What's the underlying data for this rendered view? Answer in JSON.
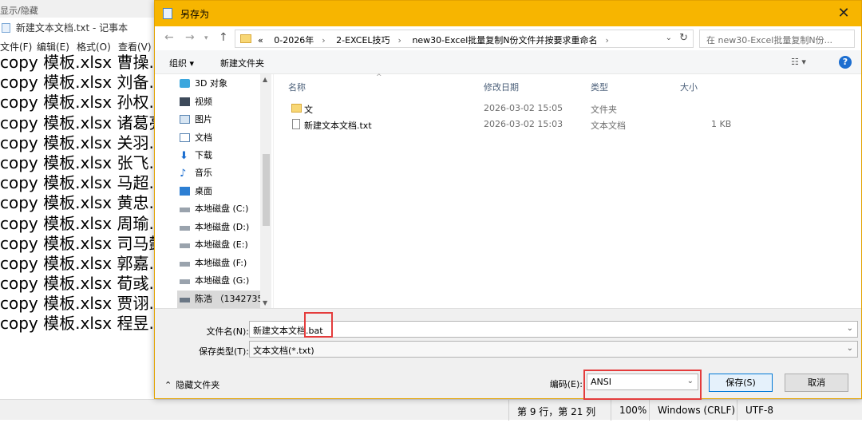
{
  "notepad": {
    "top_strip": "显示/隐藏",
    "title": "新建文本文档.txt - 记事本",
    "menu": [
      "文件(F)",
      "编辑(E)",
      "格式(O)",
      "查看(V)"
    ],
    "lines": [
      "copy 模板.xlsx 曹操.xlsx",
      "copy 模板.xlsx 刘备.xlsx",
      "copy 模板.xlsx 孙权.xlsx",
      "copy 模板.xlsx 诸葛亮.xlsx",
      "copy 模板.xlsx 关羽.xlsx",
      "copy 模板.xlsx 张飞.xlsx",
      "copy 模板.xlsx 马超.xlsx",
      "copy 模板.xlsx 黄忠.xlsx",
      "copy 模板.xlsx 周瑜.xlsx",
      "copy 模板.xlsx 司马懿.xlsx",
      "copy 模板.xlsx 郭嘉.xlsx",
      "copy 模板.xlsx 荀彧.xlsx",
      "copy 模板.xlsx 贾诩.xlsx",
      "copy 模板.xlsx 程昱.xlsx"
    ],
    "status": {
      "position": "第 9 行，第 21 列",
      "zoom": "100%",
      "line_ending": "Windows (CRLF)",
      "encoding": "UTF-8"
    }
  },
  "dialog": {
    "title": "另存为",
    "close": "✕",
    "address_prefix": "«",
    "address_parts": [
      "0-2026年",
      "2-EXCEL技巧",
      "new30-Excel批量复制N份文件并按要求重命名"
    ],
    "search_placeholder": "在 new30-Excel批量复制N份...",
    "toolbar": {
      "organize": "组织 ▾",
      "new_folder": "新建文件夹",
      "help": "?"
    },
    "nav_items": [
      {
        "label": "3D 对象",
        "icon": "3d-objects-icon"
      },
      {
        "label": "视频",
        "icon": "video-icon"
      },
      {
        "label": "图片",
        "icon": "pictures-icon"
      },
      {
        "label": "文档",
        "icon": "documents-icon"
      },
      {
        "label": "下载",
        "icon": "downloads-icon"
      },
      {
        "label": "音乐",
        "icon": "music-icon"
      },
      {
        "label": "桌面",
        "icon": "desktop-icon"
      },
      {
        "label": "本地磁盘 (C:)",
        "icon": "drive-icon"
      },
      {
        "label": "本地磁盘 (D:)",
        "icon": "drive-icon"
      },
      {
        "label": "本地磁盘 (E:)",
        "icon": "drive-icon"
      },
      {
        "label": "本地磁盘 (F:)",
        "icon": "drive-icon"
      },
      {
        "label": "本地磁盘 (G:)",
        "icon": "drive-icon"
      },
      {
        "label": "陈浩 （1342735",
        "icon": "network-drive-icon"
      }
    ],
    "columns": {
      "name": "名称",
      "date": "修改日期",
      "type": "类型",
      "size": "大小"
    },
    "files": [
      {
        "name": "文",
        "date": "2026-03-02 15:05",
        "type": "文件夹",
        "size": "",
        "icon": "folder-icon"
      },
      {
        "name": "新建文本文档.txt",
        "date": "2026-03-02 15:03",
        "type": "文本文档",
        "size": "1 KB",
        "icon": "text-file-icon"
      }
    ],
    "filename_label": "文件名(N):",
    "filename_value": "新建文本文档",
    "filename_highlight": ".bat",
    "filetype_label": "保存类型(T):",
    "filetype_value": "文本文档(*.txt)",
    "hide_folders": "隐藏文件夹",
    "encoding_label": "编码(E):",
    "encoding_value": "ANSI",
    "save_button": "保存(S)",
    "cancel_button": "取消",
    "accent_color": "#f7b500",
    "highlight_color": "#e43c3c"
  }
}
